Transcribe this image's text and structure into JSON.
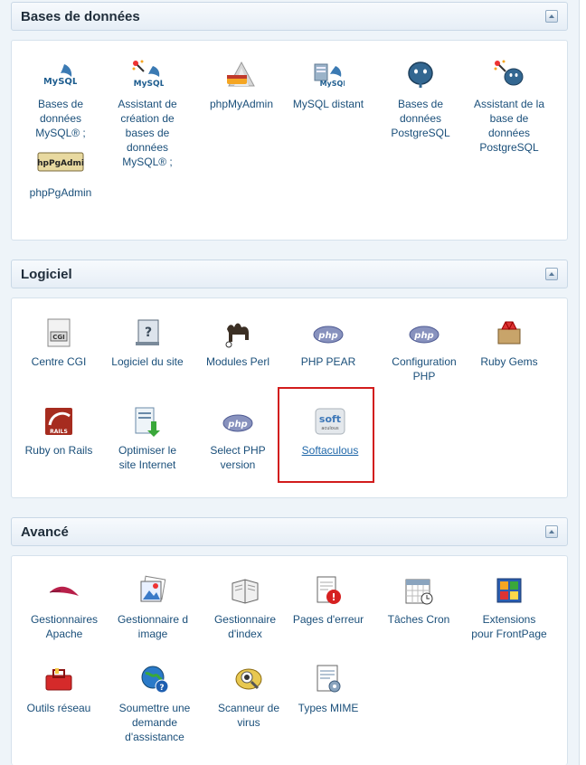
{
  "sections": [
    {
      "title": "Bases de données",
      "items": [
        {
          "label": "Bases de données MySQL® ;",
          "icon": "mysql-icon"
        },
        {
          "label": "Assistant de création de bases de données MySQL® ;",
          "icon": "mysql-wizard-icon"
        },
        {
          "label": "phpMyAdmin",
          "icon": "phpmyadmin-icon"
        },
        {
          "label": "MySQL distant",
          "icon": "remote-mysql-icon"
        },
        {
          "label": "Bases de données PostgreSQL",
          "icon": "postgresql-icon"
        },
        {
          "label": "Assistant de la base de données PostgreSQL",
          "icon": "postgresql-wizard-icon"
        },
        {
          "label": "phpPgAdmin",
          "icon": "phppgadmin-icon"
        }
      ]
    },
    {
      "title": "Logiciel",
      "items": [
        {
          "label": "Centre CGI",
          "icon": "cgi-icon"
        },
        {
          "label": "Logiciel du site",
          "icon": "site-software-icon"
        },
        {
          "label": "Modules Perl",
          "icon": "perl-camel-icon"
        },
        {
          "label": "PHP PEAR",
          "icon": "php-icon"
        },
        {
          "label": "Configuration PHP",
          "icon": "php-icon"
        },
        {
          "label": "Ruby Gems",
          "icon": "ruby-gems-icon"
        },
        {
          "label": "Ruby on Rails",
          "icon": "rails-icon"
        },
        {
          "label": "Optimiser le site Internet",
          "icon": "optimize-site-icon"
        },
        {
          "label": "Select PHP version",
          "icon": "php-icon"
        },
        {
          "label": "Softaculous",
          "icon": "softaculous-icon"
        }
      ]
    },
    {
      "title": "Avancé",
      "items": [
        {
          "label": "Gestionnaires Apache",
          "icon": "apache-feather-icon"
        },
        {
          "label": "Gestionnaire d image",
          "icon": "image-manager-icon"
        },
        {
          "label": "Gestionnaire d'index",
          "icon": "index-manager-icon"
        },
        {
          "label": "Pages d'erreur",
          "icon": "error-pages-icon"
        },
        {
          "label": "Tâches Cron",
          "icon": "cron-calendar-icon"
        },
        {
          "label": "Extensions pour FrontPage",
          "icon": "frontpage-icon"
        },
        {
          "label": "Outils réseau",
          "icon": "network-tools-icon"
        },
        {
          "label": "Soumettre une demande d'assistance",
          "icon": "support-globe-icon"
        },
        {
          "label": "Scanneur de virus",
          "icon": "virus-scanner-icon"
        },
        {
          "label": "Types MIME",
          "icon": "mime-types-icon"
        }
      ]
    }
  ],
  "icon_text": {
    "mysql": "MySQL",
    "php": "php",
    "phppgadmin": "phpPgAdmin",
    "cgi": "CGI",
    "rails": "RAILS",
    "softaculous": "soft",
    "softaculous_sub": "aculous"
  },
  "colors": {
    "highlight": "#d21c1c",
    "link": "#1a4f7a"
  }
}
